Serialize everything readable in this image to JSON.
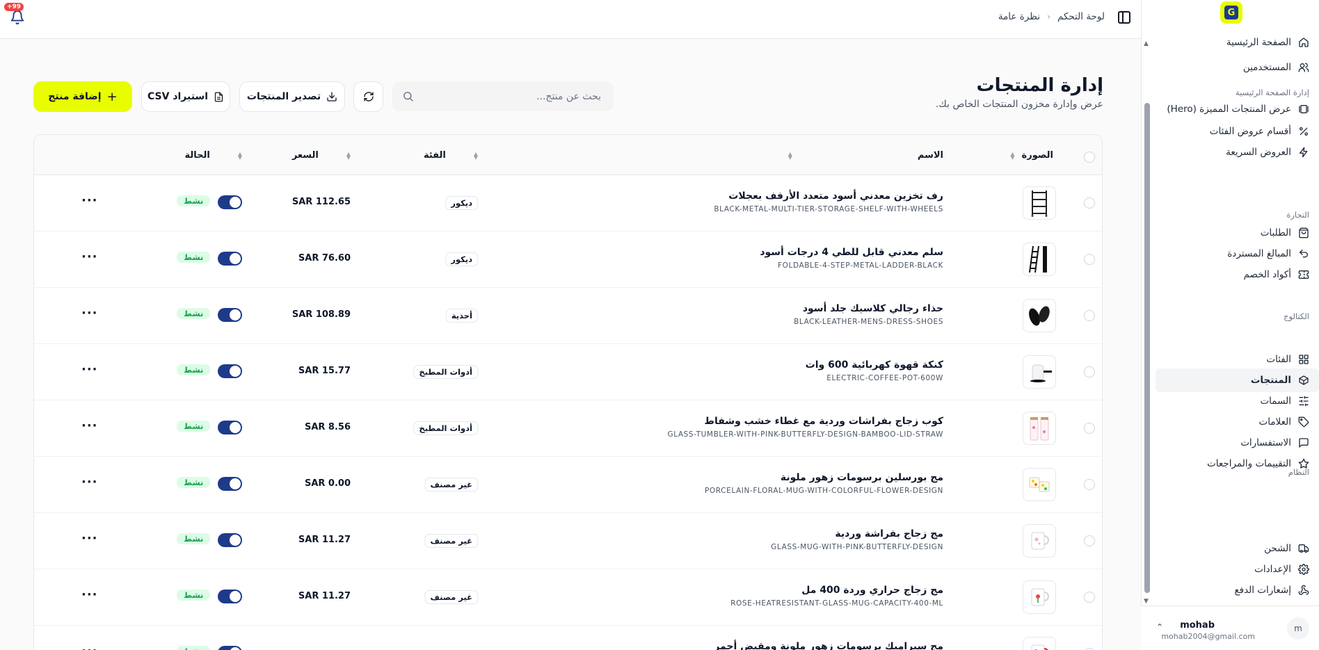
{
  "header": {
    "breadcrumb": [
      "لوحة التحكم",
      "نظرة عامة"
    ],
    "notification_count": "+99"
  },
  "sidebar": {
    "logo_letter": "G",
    "groups": [
      {
        "title": "",
        "items": [
          {
            "label": "الصفحة الرئيسية",
            "icon": "home-icon"
          },
          {
            "label": "المستخدمين",
            "icon": "users-icon"
          }
        ]
      },
      {
        "title": "إدارة الصفحة الرئيسية",
        "items": [
          {
            "label": "عرض المنتجات المميزة (Hero)",
            "icon": "gallery-icon"
          },
          {
            "label": "أقسام عروض الفئات",
            "icon": "percent-icon"
          },
          {
            "label": "العروض السريعة",
            "icon": "zap-icon"
          }
        ]
      },
      {
        "title": "التجارة",
        "items": [
          {
            "label": "الطلبات",
            "icon": "shopping-bag-icon"
          },
          {
            "label": "المبالغ المستردة",
            "icon": "undo-icon"
          },
          {
            "label": "أكواد الخصم",
            "icon": "ticket-icon"
          }
        ]
      },
      {
        "title": "الكتالوج",
        "items": [
          {
            "label": "الفئات",
            "icon": "grid-icon"
          },
          {
            "label": "المنتجات",
            "icon": "package-icon",
            "active": true
          },
          {
            "label": "السمات",
            "icon": "sliders-icon"
          },
          {
            "label": "العلامات",
            "icon": "tag-icon"
          },
          {
            "label": "الاستفسارات",
            "icon": "message-icon"
          },
          {
            "label": "التقييمات والمراجعات",
            "icon": "star-icon"
          }
        ]
      },
      {
        "title": "النظام",
        "items": [
          {
            "label": "الشحن",
            "icon": "truck-icon"
          },
          {
            "label": "الإعدادات",
            "icon": "settings-icon"
          },
          {
            "label": "إشعارات الدفع",
            "icon": "webhook-icon"
          }
        ]
      }
    ],
    "user": {
      "avatar": "m",
      "name": "mohab",
      "email": "mohab2004@gmail.com"
    }
  },
  "main": {
    "title": "إدارة المنتجات",
    "subtitle": "عرض وإدارة مخزون المنتجات الخاص بك.",
    "search_placeholder": "بحث عن منتج...",
    "export_label": "تصدير المنتجات",
    "import_label": "استيراد CSV",
    "add_label": "إضافة منتج",
    "columns": {
      "image": "الصورة",
      "name": "الاسم",
      "category": "الفئة",
      "price": "السعر",
      "status": "الحالة"
    },
    "products": [
      {
        "name": "رف تخزين معدني أسود متعدد الأرفف بعجلات",
        "slug": "BLACK-METAL-MULTI-TIER-STORAGE-SHELF-WITH-WHEELS",
        "category": "ديكور",
        "price": "SAR 112.65",
        "status": "نشط",
        "active": true,
        "thumb": "shelf"
      },
      {
        "name": "سلم معدني قابل للطي 4 درجات أسود",
        "slug": "FOLDABLE-4-STEP-METAL-LADDER-BLACK",
        "category": "ديكور",
        "price": "SAR 76.60",
        "status": "نشط",
        "active": true,
        "thumb": "ladder"
      },
      {
        "name": "حذاء رجالي كلاسيك جلد أسود",
        "slug": "BLACK-LEATHER-MENS-DRESS-SHOES",
        "category": "أحذية",
        "price": "SAR 108.89",
        "status": "نشط",
        "active": true,
        "thumb": "shoes"
      },
      {
        "name": "كنكة قهوة كهربائية 600 وات",
        "slug": "ELECTRIC-COFFEE-POT-600W",
        "category": "أدوات المطبخ",
        "price": "SAR 15.77",
        "status": "نشط",
        "active": true,
        "thumb": "pot"
      },
      {
        "name": "كوب زجاج بفراشات وردية مع غطاء خشب وشفاط",
        "slug": "GLASS-TUMBLER-WITH-PINK-BUTTERFLY-DESIGN-BAMBOO-LID-STRAW",
        "category": "أدوات المطبخ",
        "price": "SAR 8.56",
        "status": "نشط",
        "active": true,
        "thumb": "tumbler"
      },
      {
        "name": "مج بورسلين برسومات زهور ملونة",
        "slug": "PORCELAIN-FLORAL-MUG-WITH-COLORFUL-FLOWER-DESIGN",
        "category": "غير مصنف",
        "price": "SAR 0.00",
        "status": "نشط",
        "active": true,
        "thumb": "mug-floral"
      },
      {
        "name": "مج زجاج بفراشة وردية",
        "slug": "GLASS-MUG-WITH-PINK-BUTTERFLY-DESIGN",
        "category": "غير مصنف",
        "price": "SAR 11.27",
        "status": "نشط",
        "active": true,
        "thumb": "mug-glass"
      },
      {
        "name": "مج زجاج حراري وردة 400 مل",
        "slug": "ROSE-HEATRESISTANT-GLASS-MUG-CAPACITY-400-ML",
        "category": "غير مصنف",
        "price": "SAR 11.27",
        "status": "نشط",
        "active": true,
        "thumb": "mug-rose"
      },
      {
        "name": "مج سيراميك برسومات زهور ملونة ومقبض أحمر",
        "slug": "",
        "category": "",
        "price": "",
        "status": "نشط",
        "active": true,
        "thumb": "mug-red"
      }
    ]
  }
}
